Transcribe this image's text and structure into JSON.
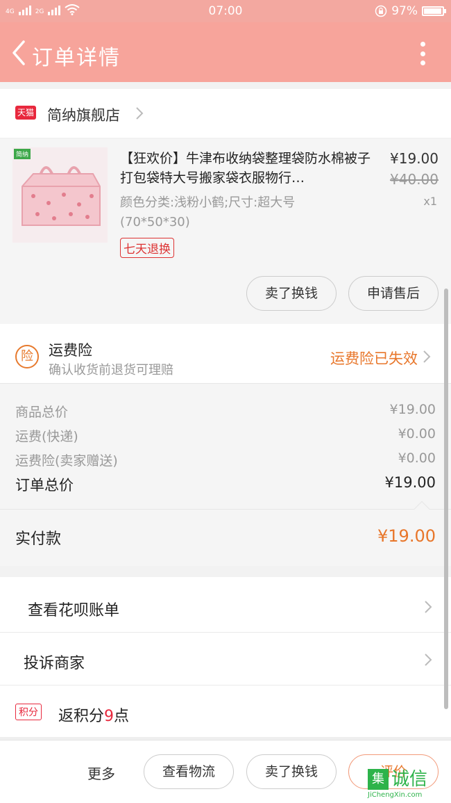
{
  "status_bar": {
    "net1": "4G",
    "net2": "2G",
    "time": "07:00",
    "battery": "97%",
    "battery_level": 0.97
  },
  "header": {
    "title": "订单详情"
  },
  "store": {
    "badge": "天猫",
    "name": "简纳旗舰店"
  },
  "product": {
    "thumb_tag": "简纳",
    "title": "【狂欢价】牛津布收纳袋整理袋防水棉被子打包袋特大号搬家袋衣服物行…",
    "spec": "颜色分类:浅粉小鹤;尺寸:超大号(70*50*30)",
    "badge": "七天退换",
    "price": "¥19.00",
    "original_price": "¥40.00",
    "qty": "x1",
    "btn_resell": "卖了换钱",
    "btn_aftersale": "申请售后"
  },
  "insurance": {
    "icon_text": "险",
    "title": "运费险",
    "subtitle": "确认收货前退货可理赔",
    "status": "运费险已失效"
  },
  "summary": {
    "goods_label": "商品总价",
    "goods_value": "¥19.00",
    "ship_label": "运费(快递)",
    "ship_value": "¥0.00",
    "ins_label": "运费险(卖家赠送)",
    "ins_value": "¥0.00",
    "total_label": "订单总价",
    "total_value": "¥19.00",
    "paid_label": "实付款",
    "paid_value": "¥19.00"
  },
  "actions": {
    "huabei": "查看花呗账单",
    "complain": "投诉商家",
    "points_badge": "积分",
    "points_prefix": "返积分",
    "points_num": "9",
    "points_suffix": "点"
  },
  "bottom": {
    "more": "更多",
    "logistics": "查看物流",
    "resell": "卖了换钱",
    "review": "评价"
  },
  "watermark": {
    "sq": "集",
    "text": "诚信",
    "url": "JiChengXin.com"
  }
}
